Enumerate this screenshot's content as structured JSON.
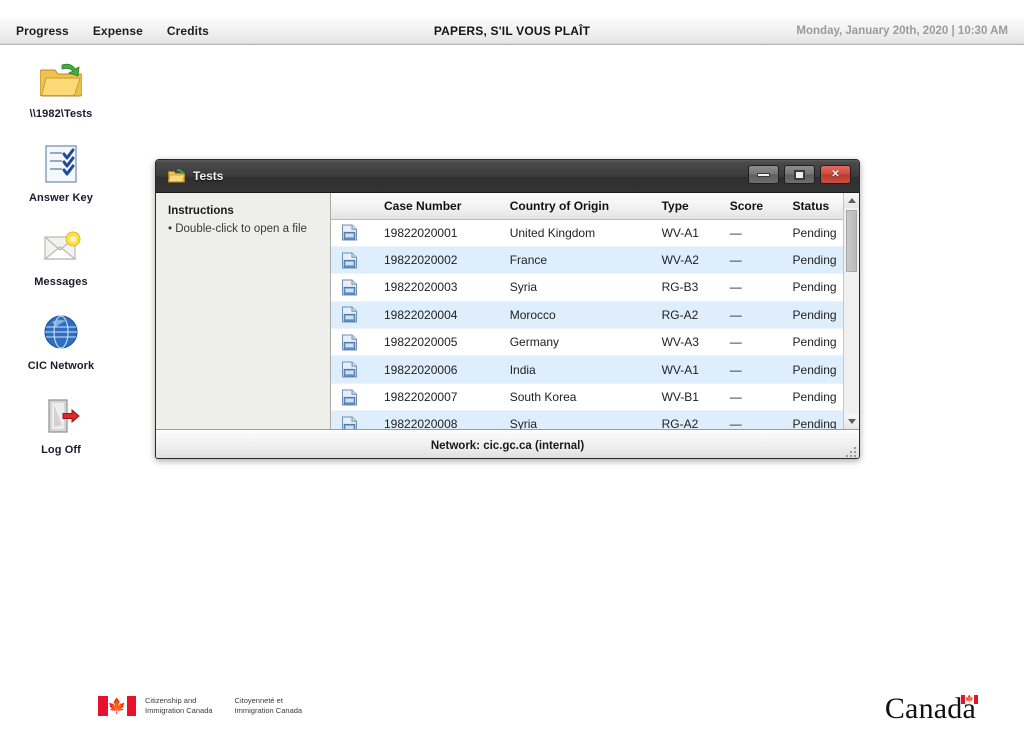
{
  "topbar": {
    "menu_items": [
      {
        "label": "Progress",
        "name": "menu-progress"
      },
      {
        "label": "Expense",
        "name": "menu-expense"
      },
      {
        "label": "Credits",
        "name": "menu-credits"
      }
    ],
    "app_title": "PAPERS, S'IL VOUS PLAÎT",
    "clock": "Monday, January 20th, 2020 | 10:30 AM"
  },
  "desktop_icons": [
    {
      "label": "\\\\1982\\Tests",
      "icon": "folder-open-icon"
    },
    {
      "label": "Answer Key",
      "icon": "checklist-icon"
    },
    {
      "label": "Messages",
      "icon": "mail-icon"
    },
    {
      "label": "CIC Network",
      "icon": "globe-icon"
    },
    {
      "label": "Log Off",
      "icon": "logoff-door-icon"
    }
  ],
  "window": {
    "title": "Tests",
    "title_icon": "folder-icon",
    "controls": {
      "minimize_label": "Minimize",
      "maximize_label": "Maximize",
      "close_label": "✕"
    },
    "instructions": {
      "heading": "Instructions",
      "body": "• Double-click to open a file"
    },
    "table": {
      "columns": [
        "",
        "Case Number",
        "Country of Origin",
        "Type",
        "Score",
        "Status"
      ],
      "rows": [
        {
          "case": "19822020001",
          "country": "United Kingdom",
          "type": "WV-A1",
          "score": "—",
          "status": "Pending"
        },
        {
          "case": "19822020002",
          "country": "France",
          "type": "WV-A2",
          "score": "—",
          "status": "Pending"
        },
        {
          "case": "19822020003",
          "country": "Syria",
          "type": "RG-B3",
          "score": "—",
          "status": "Pending"
        },
        {
          "case": "19822020004",
          "country": "Morocco",
          "type": "RG-A2",
          "score": "—",
          "status": "Pending"
        },
        {
          "case": "19822020005",
          "country": "Germany",
          "type": "WV-A3",
          "score": "—",
          "status": "Pending"
        },
        {
          "case": "19822020006",
          "country": "India",
          "type": "WV-A1",
          "score": "—",
          "status": "Pending"
        },
        {
          "case": "19822020007",
          "country": "South Korea",
          "type": "WV-B1",
          "score": "—",
          "status": "Pending"
        },
        {
          "case": "19822020008",
          "country": "Syria",
          "type": "RG-A2",
          "score": "—",
          "status": "Pending"
        }
      ]
    },
    "statusbar": "Network: cic.gc.ca (internal)"
  },
  "footer": {
    "dept_en": "Citizenship and\nImmigration Canada",
    "dept_fr": "Citoyenneté et\nImmigration Canada",
    "wordmark": "Canada",
    "maple_leaf": "🍁"
  },
  "colors": {
    "accent_row": "#dfeefc",
    "flag_red": "#e8112d",
    "close_red": "#cf4c3f",
    "titlebar": "#3b3b3b"
  }
}
